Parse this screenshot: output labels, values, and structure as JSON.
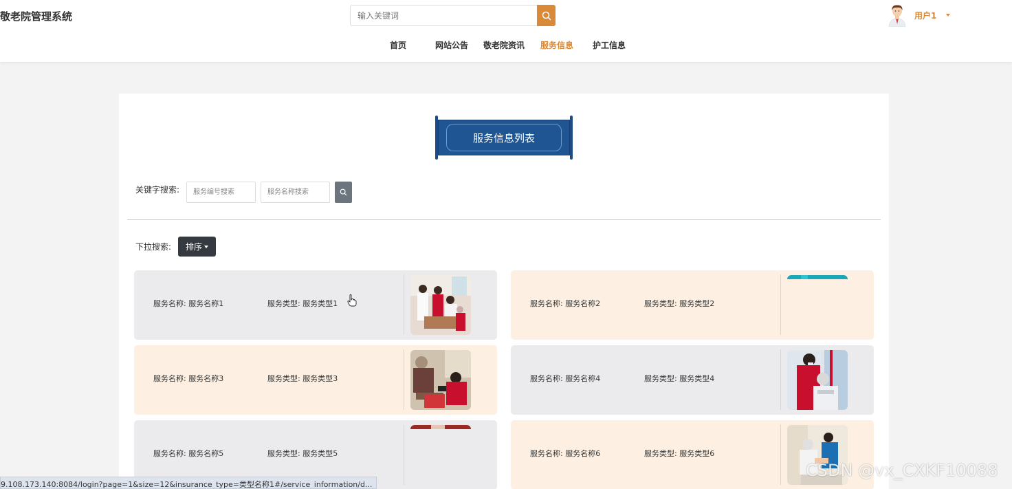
{
  "header": {
    "site_title": "敬老院管理系统",
    "search_placeholder": "输入关键词",
    "user_name": "用户1"
  },
  "nav": {
    "items": [
      {
        "label": "首页",
        "active": false
      },
      {
        "label": "网站公告",
        "active": false
      },
      {
        "label": "敬老院资讯",
        "active": false
      },
      {
        "label": "服务信息",
        "active": true
      },
      {
        "label": "护工信息",
        "active": false
      }
    ]
  },
  "page": {
    "title": "服务信息列表",
    "keyword_label": "关键字搜索:",
    "search_number_placeholder": "服务编号搜索",
    "search_name_placeholder": "服务名称搜索",
    "dropdown_label": "下拉搜索:",
    "sort_label": "排序"
  },
  "cards": [
    {
      "name": "服务名称: 服务名称1",
      "type": "服务类型: 服务类型1",
      "color": "gray",
      "image": "service-photo-1"
    },
    {
      "name": "服务名称: 服务名称2",
      "type": "服务类型: 服务类型2",
      "color": "cream",
      "image": "service-photo-2"
    },
    {
      "name": "服务名称: 服务名称3",
      "type": "服务类型: 服务类型3",
      "color": "cream",
      "image": "service-photo-3"
    },
    {
      "name": "服务名称: 服务名称4",
      "type": "服务类型: 服务类型4",
      "color": "gray",
      "image": "service-photo-4"
    },
    {
      "name": "服务名称: 服务名称5",
      "type": "服务类型: 服务类型5",
      "color": "gray",
      "image": "service-photo-5"
    },
    {
      "name": "服务名称: 服务名称6",
      "type": "服务类型: 服务类型6",
      "color": "cream",
      "image": "service-photo-6"
    }
  ],
  "status_bar": {
    "url": "9.108.173.140:8084/login?page=1&size=12&insurance_type=类型名称1#/service_information/d..."
  },
  "watermark": "CSDN @vx_CXKF10088",
  "colors": {
    "accent": "#d98a39",
    "banner": "#1e5592",
    "card_gray": "#ebebed",
    "card_cream": "#fdf0e2",
    "sort_button": "#343a40"
  }
}
